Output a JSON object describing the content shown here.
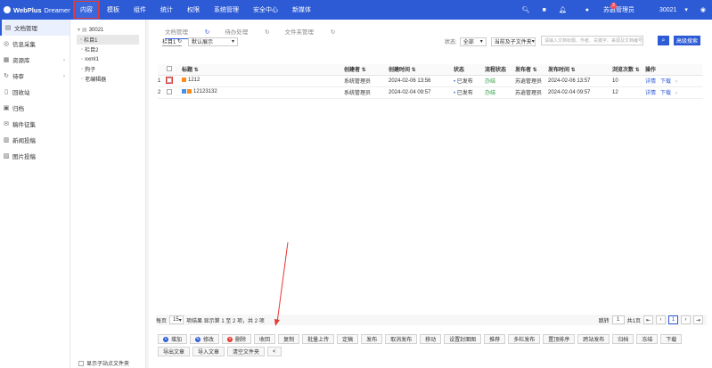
{
  "app": {
    "brand": "WebPlus",
    "product": "Dreamer"
  },
  "nav": [
    "内容",
    "模板",
    "组件",
    "统计",
    "权限",
    "系统管理",
    "安全中心",
    "新媒体"
  ],
  "topright": {
    "notifications": "3",
    "user": "苏逍管理员",
    "site": "30021"
  },
  "sidebar": [
    {
      "label": "文档管理",
      "icon": "doc-icon",
      "active": true
    },
    {
      "label": "信息采集",
      "icon": "collect-icon"
    },
    {
      "label": "资源库",
      "icon": "resource-icon",
      "arrow": true
    },
    {
      "label": "待审",
      "icon": "review-icon",
      "arrow": true
    },
    {
      "label": "回收站",
      "icon": "trash-icon"
    },
    {
      "label": "归档",
      "icon": "archive-icon"
    },
    {
      "label": "稿件征集",
      "icon": "manuscript-icon"
    },
    {
      "label": "新闻投稿",
      "icon": "news-icon"
    },
    {
      "label": "图片投稿",
      "icon": "image-icon"
    }
  ],
  "tree": {
    "root": "30021",
    "children": [
      "栏目1",
      "栏目2",
      "xxml1",
      "狗子",
      "老编辑器"
    ],
    "footer": "显示子站点文件夹"
  },
  "tabs": [
    "文档管理",
    "待办处理",
    "文件夹管理"
  ],
  "filter": {
    "column": "栏目1",
    "display": "默认展示",
    "status_label": "状态:",
    "status": "全部",
    "scope": "当前及子文件夹",
    "search_placeholder": "请输入文档标题、作者、关键字、来源及文档编号",
    "adv": "高级搜索"
  },
  "table": {
    "headers": [
      "标题",
      "创建者",
      "创建时间",
      "状态",
      "流程状态",
      "发布者",
      "发布时间",
      "浏览次数",
      "操作"
    ],
    "rows": [
      {
        "no": "1",
        "title": "1212",
        "creator": "系统管理员",
        "ctime": "2024-02-06 13:56",
        "status": "已发布",
        "flow": "办结",
        "publisher": "苏逍管理员",
        "ptime": "2024-02-06 13:57",
        "views": "10",
        "op1": "详情",
        "op2": "下载"
      },
      {
        "no": "2",
        "title": "12123132",
        "creator": "系统管理员",
        "ctime": "2024-02-04 09:57",
        "status": "已发布",
        "flow": "办结",
        "publisher": "苏逍管理员",
        "ptime": "2024-02-04 09:57",
        "views": "12",
        "op1": "详情",
        "op2": "下载"
      }
    ]
  },
  "pager": {
    "per_page_label": "每页",
    "per_page": "15",
    "summary": "项结果 显示第 1 至 2 项，共 2 项",
    "jump": "跳转",
    "jump_val": "1",
    "pages": "共1页",
    "current": "1"
  },
  "toolbar": [
    "增加",
    "修改",
    "删除",
    "收回",
    "复制",
    "批量上传",
    "定稿",
    "发布",
    "取消发布",
    "移动",
    "设置封面图",
    "推荐",
    "多栏发布",
    "置顶排序",
    "跨站发布",
    "归档",
    "冻结",
    "下载",
    "导出文章",
    "导入文章",
    "清空文件夹",
    "<"
  ],
  "colors": {
    "primary": "#2d5bd6",
    "annotation": "#e53935"
  }
}
